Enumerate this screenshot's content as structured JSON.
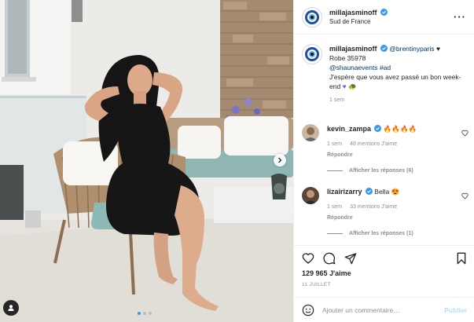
{
  "post": {
    "username": "millajasminoff",
    "location": "Sud de France",
    "more_icon": "more-icon"
  },
  "caption": {
    "username": "millajasminoff",
    "mention": "@brentinyparis",
    "line2": "Robe 35978",
    "mention2": "@shaunaevents",
    "hashtag": "#ad",
    "text": "J'espère que vous avez passé un bon week-end",
    "time": "1 sem"
  },
  "comments": [
    {
      "username": "kevin_zampa",
      "text": "🔥🔥🔥🔥",
      "time": "1 sem",
      "likes": "48 mentions J'aime",
      "reply": "Répondre",
      "replies": "Afficher les réponses (6)"
    },
    {
      "username": "lizairizarry",
      "text": "Bella 😍",
      "time": "1 sem",
      "likes": "33 mentions J'aime",
      "reply": "Répondre",
      "replies": "Afficher les réponses (1)"
    }
  ],
  "stats": {
    "likes": "129 965 J'aime",
    "date": "11 JUILLET"
  },
  "composer": {
    "placeholder": "Ajouter un commentaire…",
    "publish": "Publier"
  },
  "colors": {
    "verified": "#3897f0",
    "link": "#00376b",
    "muted": "#8e8e8e",
    "publish_disabled": "#b2dffc"
  }
}
